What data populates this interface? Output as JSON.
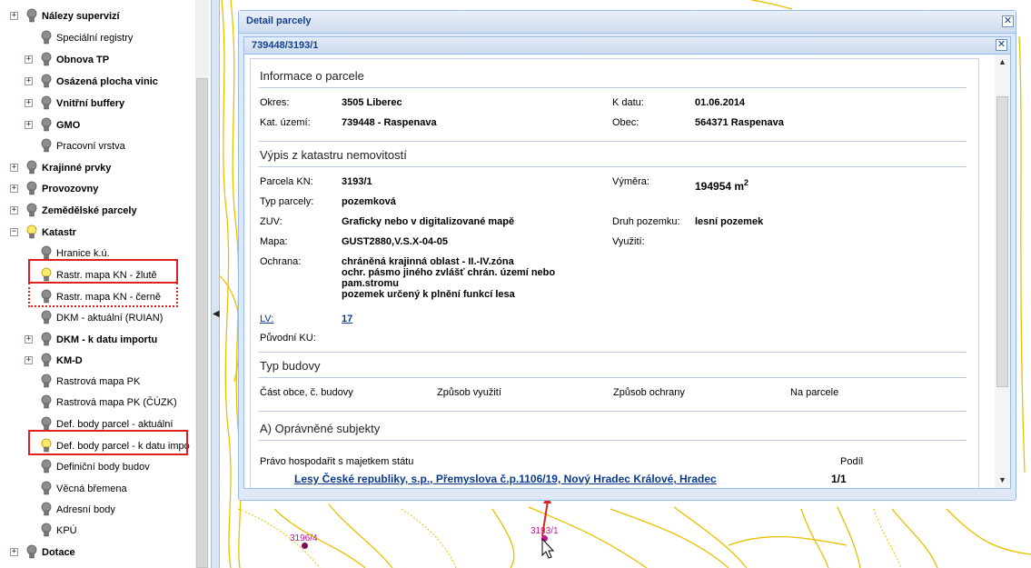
{
  "tree": {
    "items": [
      {
        "label": "Nálezy supervizí",
        "bold": true,
        "expander": "+",
        "bulb": "grey"
      },
      {
        "label": "Speciální registry",
        "bold": false,
        "expander": "",
        "bulb": "grey"
      },
      {
        "label": "Obnova TP",
        "bold": true,
        "expander": "+",
        "bulb": "grey"
      },
      {
        "label": "Osázená plocha vinic",
        "bold": true,
        "expander": "+",
        "bulb": "grey"
      },
      {
        "label": "Vnitřní buffery",
        "bold": true,
        "expander": "+",
        "bulb": "grey"
      },
      {
        "label": "GMO",
        "bold": true,
        "expander": "+",
        "bulb": "grey"
      },
      {
        "label": "Pracovní vrstva",
        "bold": false,
        "expander": "",
        "bulb": "grey"
      },
      {
        "label": "Krajinné prvky",
        "bold": true,
        "expander": "+",
        "bulb": "grey"
      },
      {
        "label": "Provozovny",
        "bold": true,
        "expander": "+",
        "bulb": "grey"
      },
      {
        "label": "Zemědělské parcely",
        "bold": true,
        "expander": "+",
        "bulb": "grey"
      },
      {
        "label": "Katastr",
        "bold": true,
        "expander": "−",
        "bulb": "yellow"
      },
      {
        "label": "Hranice k.ú.",
        "bold": false,
        "expander": "",
        "bulb": "grey"
      },
      {
        "label": "Rastr. mapa KN - žlutě",
        "bold": false,
        "expander": "",
        "bulb": "yellow"
      },
      {
        "label": "Rastr. mapa KN - černě",
        "bold": false,
        "expander": "",
        "bulb": "grey"
      },
      {
        "label": "DKM - aktuální (RUIAN)",
        "bold": false,
        "expander": "",
        "bulb": "grey"
      },
      {
        "label": "DKM - k datu importu",
        "bold": true,
        "expander": "+",
        "bulb": "grey"
      },
      {
        "label": "KM-D",
        "bold": true,
        "expander": "+",
        "bulb": "grey"
      },
      {
        "label": "Rastrová mapa PK",
        "bold": false,
        "expander": "",
        "bulb": "grey"
      },
      {
        "label": "Rastrová mapa PK (ČÚZK)",
        "bold": false,
        "expander": "",
        "bulb": "grey"
      },
      {
        "label": "Def. body parcel - aktuální",
        "bold": false,
        "expander": "",
        "bulb": "grey"
      },
      {
        "label": "Def. body parcel - k datu impo",
        "bold": false,
        "expander": "",
        "bulb": "yellow"
      },
      {
        "label": "Definiční body budov",
        "bold": false,
        "expander": "",
        "bulb": "grey"
      },
      {
        "label": "Věcná břemena",
        "bold": false,
        "expander": "",
        "bulb": "grey"
      },
      {
        "label": "Adresní body",
        "bold": false,
        "expander": "",
        "bulb": "grey"
      },
      {
        "label": "KPÚ",
        "bold": false,
        "expander": "",
        "bulb": "grey"
      },
      {
        "label": "Dotace",
        "bold": true,
        "expander": "+",
        "bulb": "grey"
      }
    ]
  },
  "map": {
    "parcel_labels": [
      "3196/4",
      "3193/1"
    ]
  },
  "dialog": {
    "title": "Detail parcely",
    "tab_title": "739448/3193/1",
    "info": {
      "heading": "Informace o parcele",
      "okres_label": "Okres:",
      "okres_value": "3505 Liberec",
      "kdatu_label": "K datu:",
      "kdatu_value": "01.06.2014",
      "katuzemi_label": "Kat. území:",
      "katuzemi_value": "739448 - Raspenava",
      "obec_label": "Obec:",
      "obec_value": "564371 Raspenava"
    },
    "vypis": {
      "heading": "Výpis z katastru nemovitostí",
      "parcela_label": "Parcela KN:",
      "parcela_value": "3193/1",
      "vymera_label": "Výměra:",
      "vymera_value": "194954 m",
      "vymera_sup": "2",
      "typ_label": "Typ parcely:",
      "typ_value": "pozemková",
      "zuv_label": "ZUV:",
      "zuv_value": "Graficky nebo v digitalizované mapě",
      "druh_label": "Druh pozemku:",
      "druh_value": "lesní pozemek",
      "mapa_label": "Mapa:",
      "mapa_value": "GUST2880,V.S.X-04-05",
      "vyuziti_label": "Využití:",
      "ochrana_label": "Ochrana:",
      "ochrana_lines": [
        "chráněná krajinná oblast - II.-IV.zóna",
        "ochr. pásmo jiného zvlášť chrán. území nebo pam.stromu",
        "pozemek určený k plnění funkcí lesa"
      ],
      "lv_label": "LV:",
      "lv_value": "17",
      "puvodni_label": "Původní KU:"
    },
    "budovy": {
      "heading": "Typ budovy",
      "cols": [
        "Část obce, č. budovy",
        "Způsob využití",
        "Způsob ochrany",
        "Na parcele"
      ]
    },
    "subjekty": {
      "heading": "A) Oprávněné subjekty",
      "right_label": "Právo hospodařit s majetkem státu",
      "podil_label": "Podíl",
      "owner": "Lesy České republiky, s.p., Přemyslova č.p.1106/19, Nový Hradec Králové, Hradec",
      "podil_value": "1/1"
    }
  }
}
